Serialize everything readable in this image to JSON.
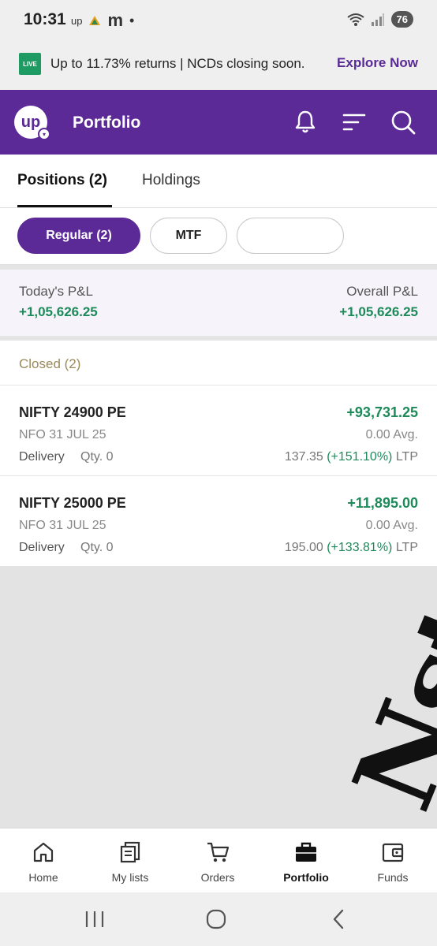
{
  "status_bar": {
    "time": "10:31",
    "notif_up": "up",
    "notif_m": "m",
    "battery": "76"
  },
  "promo": {
    "badge": "LIVE",
    "text": "Up to 11.73% returns | NCDs closing soon.",
    "link": "Explore Now"
  },
  "header": {
    "logo": "up",
    "title": "Portfolio",
    "icons": [
      "bell-icon",
      "filter-icon",
      "search-icon"
    ]
  },
  "tabs": [
    {
      "label": "Positions (2)",
      "active": true
    },
    {
      "label": "Holdings",
      "active": false
    }
  ],
  "filters": [
    {
      "label": "Regular (2)",
      "active": true
    },
    {
      "label": "MTF",
      "active": false
    },
    {
      "label": "",
      "active": false
    }
  ],
  "pnl": {
    "today_label": "Today's P&L",
    "today_value": "+1,05,626.25",
    "overall_label": "Overall P&L",
    "overall_value": "+1,05,626.25"
  },
  "closed": {
    "title": "Closed (2)"
  },
  "positions": [
    {
      "name": "NIFTY 24900 PE",
      "pnl": "+93,731.25",
      "exchange_expiry": "NFO 31 JUL 25",
      "avg": "0.00 Avg.",
      "product": "Delivery",
      "qty": "Qty. 0",
      "ltp": "137.35",
      "change": "(+151.10%)",
      "ltp_label": "LTP"
    },
    {
      "name": "NIFTY 25000 PE",
      "pnl": "+11,895.00",
      "exchange_expiry": "NFO 31 JUL 25",
      "avg": "0.00 Avg.",
      "product": "Delivery",
      "qty": "Qty. 0",
      "ltp": "195.00",
      "change": "(+133.81%)",
      "ltp_label": "LTP"
    }
  ],
  "watermark": "Nstraderfo",
  "bottom_nav": [
    {
      "label": "Home",
      "icon": "home-icon",
      "active": false
    },
    {
      "label": "My lists",
      "icon": "lists-icon",
      "active": false
    },
    {
      "label": "Orders",
      "icon": "cart-icon",
      "active": false
    },
    {
      "label": "Portfolio",
      "icon": "briefcase-icon",
      "active": true
    },
    {
      "label": "Funds",
      "icon": "wallet-icon",
      "active": false
    }
  ],
  "colors": {
    "brand": "#5b2a96",
    "profit": "#1e8a5a",
    "closed_label": "#9a8a5a"
  }
}
